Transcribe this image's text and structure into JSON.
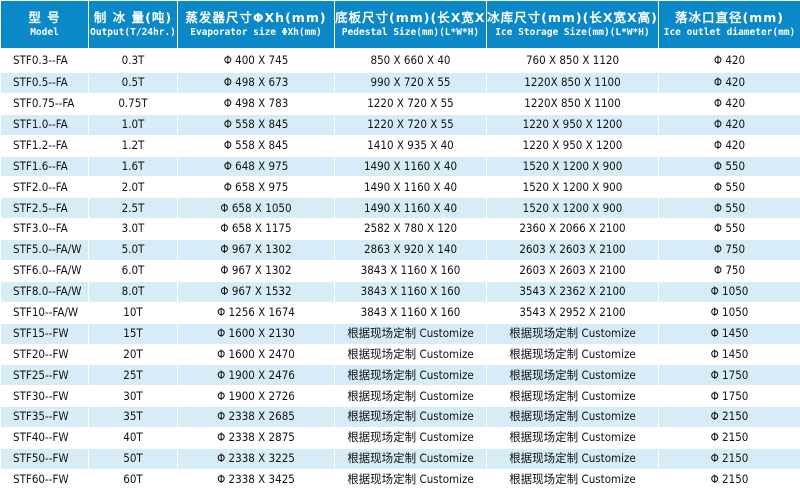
{
  "headers": [
    {
      "zh": "型 号",
      "en": "Model"
    },
    {
      "zh": "制 冰 量(吨)",
      "en": "Output(T/24hr.)"
    },
    {
      "zh": "蒸发器尺寸ΦXh(mm)",
      "en": "Evaporator size ΦXh(mm)"
    },
    {
      "zh": "底板尺寸(mm)(长X宽X高)",
      "en": "Pedestal Size(mm)(L*W*H)"
    },
    {
      "zh": "冰库尺寸(mm)(长X宽X高)",
      "en": "Ice Storage Size(mm)(L*W*H)"
    },
    {
      "zh": "落冰口直径(mm)",
      "en": "Ice outlet diameter(mm)"
    }
  ],
  "rows": [
    [
      "STF0.3--FA",
      "0.3T",
      "Φ 400 X 745",
      "850 X 660 X 40",
      "760 X 850 X 1120",
      "Φ 420"
    ],
    [
      "STF0.5--FA",
      "0.5T",
      "Φ 498 X 673",
      "990 X 720 X 55",
      "1220X 850 X 1100",
      "Φ 420"
    ],
    [
      "STF0.75--FA",
      "0.75T",
      "Φ 498 X 783",
      "1220 X 720 X 55",
      "1220X 850 X 1100",
      "Φ 420"
    ],
    [
      "STF1.0--FA",
      "1.0T",
      "Φ 558 X 845",
      "1220 X 720 X 55",
      "1220 X 950 X 1200",
      "Φ 420"
    ],
    [
      "STF1.2--FA",
      "1.2T",
      "Φ 558 X 845",
      "1410 X 935 X 40",
      "1220 X 950 X 1200",
      "Φ 420"
    ],
    [
      "STF1.6--FA",
      "1.6T",
      "Φ 648 X 975",
      "1490 X 1160 X 40",
      "1520 X 1200 X 900",
      "Φ 550"
    ],
    [
      "STF2.0--FA",
      "2.0T",
      "Φ 658 X 975",
      "1490 X 1160 X 40",
      "1520 X 1200 X 900",
      "Φ 550"
    ],
    [
      "STF2.5--FA",
      "2.5T",
      "Φ 658 X 1050",
      "1490 X 1160 X 40",
      "1520 X 1200 X 900",
      "Φ 550"
    ],
    [
      "STF3.0--FA",
      "3.0T",
      "Φ 658 X 1175",
      "2582 X 780 X 120",
      "2360 X 2066 X 2100",
      "Φ 550"
    ],
    [
      "STF5.0--FA/W",
      "5.0T",
      "Φ 967 X 1302",
      "2863 X 920 X 140",
      "2603 X 2603 X 2100",
      "Φ 750"
    ],
    [
      "STF6.0--FA/W",
      "6.0T",
      "Φ 967 X 1302",
      "3843 X 1160 X 160",
      "2603 X 2603 X 2100",
      "Φ 750"
    ],
    [
      "STF8.0--FA/W",
      "8.0T",
      "Φ 967 X 1532",
      "3843 X 1160 X 160",
      "3543 X 2362 X 2100",
      "Φ 1050"
    ],
    [
      "STF10--FA/W",
      "10T",
      "Φ 1256 X 1674",
      "3843 X 1160 X 160",
      "3543 X 2952 X 2100",
      "Φ 1050"
    ],
    [
      "STF15--FW",
      "15T",
      "Φ 1600 X 2130",
      "根据现场定制 Customize",
      "根据现场定制 Customize",
      "Φ 1450"
    ],
    [
      "STF20--FW",
      "20T",
      "Φ 1600 X 2470",
      "根据现场定制 Customize",
      "根据现场定制 Customize",
      "Φ 1450"
    ],
    [
      "STF25--FW",
      "25T",
      "Φ 1900 X 2476",
      "根据现场定制 Customize",
      "根据现场定制 Customize",
      "Φ 1750"
    ],
    [
      "STF30--FW",
      "30T",
      "Φ 1900 X 2726",
      "根据现场定制 Customize",
      "根据现场定制 Customize",
      "Φ 1750"
    ],
    [
      "STF35--FW",
      "35T",
      "Φ 2338 X 2685",
      "根据现场定制 Customize",
      "根据现场定制 Customize",
      "Φ 2150"
    ],
    [
      "STF40--FW",
      "40T",
      "Φ 2338 X 2875",
      "根据现场定制 Customize",
      "根据现场定制 Customize",
      "Φ 2150"
    ],
    [
      "STF50--FW",
      "50T",
      "Φ 2338 X 3225",
      "根据现场定制 Customize",
      "根据现场定制 Customize",
      "Φ 2150"
    ],
    [
      "STF60--FW",
      "60T",
      "Φ 2338 X 3425",
      "根据现场定制 Customize",
      "根据现场定制 Customize",
      "Φ 2150"
    ]
  ],
  "colors": {
    "header_bg": "#0a88c8",
    "stripe": "#d6ecf7",
    "text": "#111111"
  }
}
